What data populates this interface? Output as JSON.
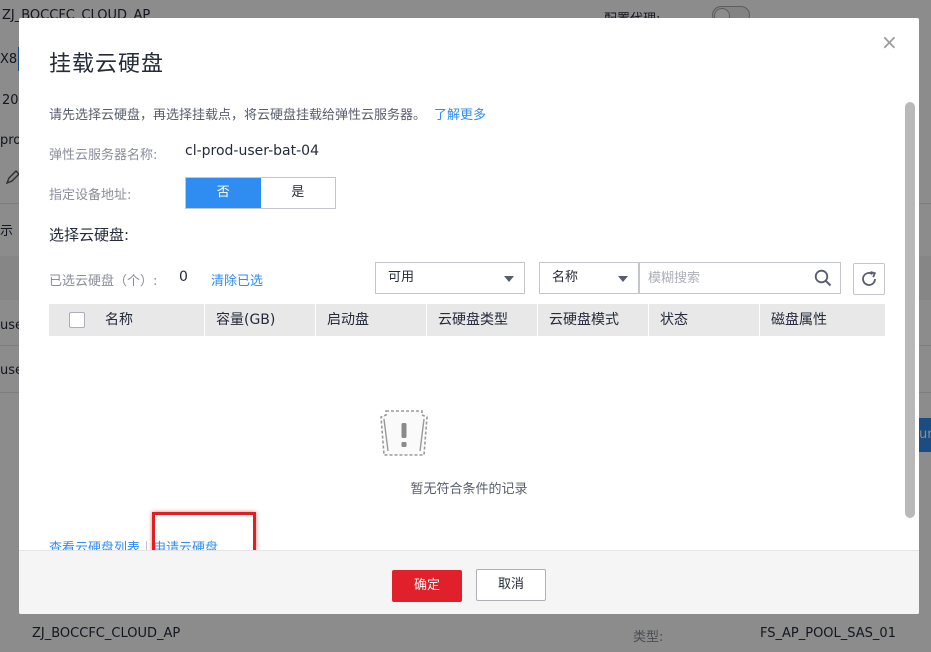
{
  "background": {
    "top_left": "ZJ_BOCCFC_CLOUD_AP",
    "top_right_label": "配置代理:",
    "side_fragments": [
      "X8",
      "20",
      "pro",
      "示",
      "use",
      "use"
    ],
    "button_fragment": "ur",
    "bottom_left": "ZJ_BOCCFC_CLOUD_AP",
    "bottom_label": "类型:",
    "bottom_value": "FS_AP_POOL_SAS_01"
  },
  "dialog": {
    "title": "挂载云硬盘",
    "close": "×",
    "description": "请先选择云硬盘，再选择挂载点，将云硬盘挂载给弹性云服务器。",
    "learn_more": "了解更多",
    "server_name_label": "弹性云服务器名称:",
    "server_name_value": "cl-prod-user-bat-04",
    "device_address_label": "指定设备地址:",
    "device_address_options": [
      "否",
      "是"
    ],
    "device_address_selected": "否",
    "select_section_title": "选择云硬盘:",
    "selected_count_label": "已选云硬盘（个）:",
    "selected_count": "0",
    "clear_selected": "清除已选",
    "status_filter": "可用",
    "search_field_select": "名称",
    "search_placeholder": "模糊搜索",
    "table_headers": [
      "名称",
      "容量(GB)",
      "启动盘",
      "云硬盘类型",
      "云硬盘模式",
      "状态",
      "磁盘属性"
    ],
    "empty_text": "暂无符合条件的记录",
    "view_disk_list": "查看云硬盘列表",
    "apply_disk": "申请云硬盘",
    "confirm": "确定",
    "cancel": "取消"
  },
  "colors": {
    "primary": "#2f8cf0",
    "danger": "#e0202a",
    "highlight_box": "#e02020"
  }
}
